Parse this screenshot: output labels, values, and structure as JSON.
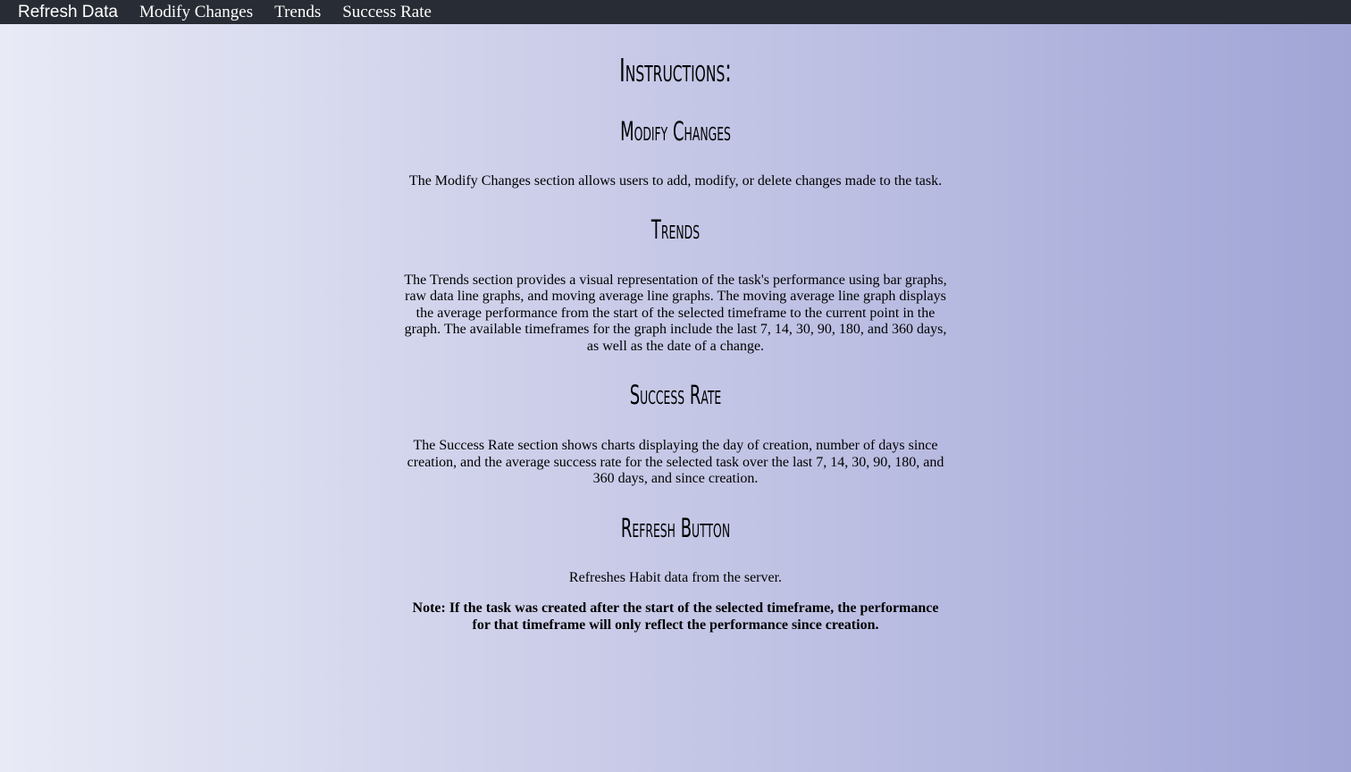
{
  "nav": {
    "refresh_label": "Refresh Data",
    "links": [
      "Modify Changes",
      "Trends",
      "Success Rate"
    ]
  },
  "instructions": {
    "title": "Instructions:",
    "modify": {
      "heading": "Modify Changes",
      "body": "The Modify Changes section allows users to add, modify, or delete changes made to the task."
    },
    "trends": {
      "heading": "Trends",
      "body": "The Trends section provides a visual representation of the task's performance using bar graphs, raw data line graphs, and moving average line graphs. The moving average line graph displays the average performance from the start of the selected timeframe to the current point in the graph. The available timeframes for the graph include the last 7, 14, 30, 90, 180, and 360 days, as well as the date of a change."
    },
    "success": {
      "heading": "Success Rate",
      "body": "The Success Rate section shows charts displaying the day of creation, number of days since creation, and the average success rate for the selected task over the last 7, 14, 30, 90, 180, and 360 days, and since creation."
    },
    "refresh": {
      "heading": "Refresh Button",
      "body": "Refreshes Habit data from the server."
    },
    "note": "Note: If the task was created after the start of the selected timeframe, the performance for that timeframe will only reflect the performance since creation."
  },
  "colors": {
    "navbar": "#282c34",
    "gradient_start": "#e8eaf6",
    "gradient_end": "#a1a5d6"
  }
}
